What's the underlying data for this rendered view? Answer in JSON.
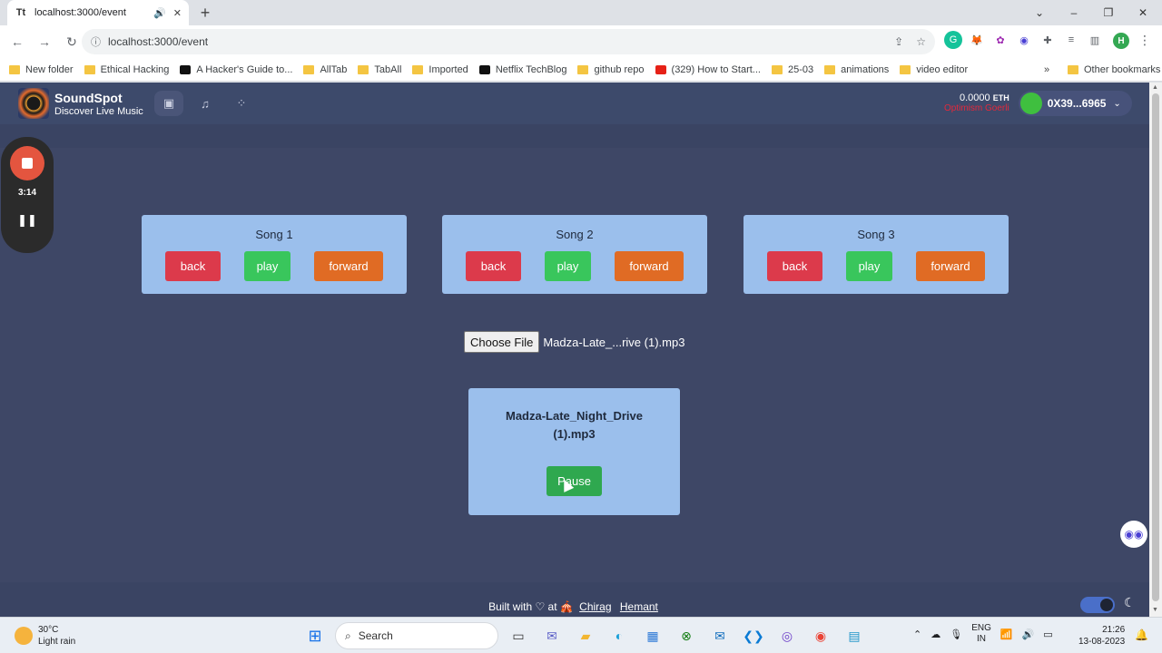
{
  "browser": {
    "tab_title": "localhost:3000/event",
    "tab_favicon": "Tt",
    "url": "localhost:3000/event",
    "profile_initial": "H",
    "bookmarks": [
      {
        "label": "New folder",
        "icon": "folder"
      },
      {
        "label": "Ethical Hacking",
        "icon": "folder"
      },
      {
        "label": "A Hacker's Guide to...",
        "icon": "medium"
      },
      {
        "label": "AllTab",
        "icon": "folder"
      },
      {
        "label": "TabAll",
        "icon": "folder"
      },
      {
        "label": "Imported",
        "icon": "folder"
      },
      {
        "label": "Netflix TechBlog",
        "icon": "medium"
      },
      {
        "label": "github repo",
        "icon": "folder"
      },
      {
        "label": "(329) How to Start...",
        "icon": "youtube"
      },
      {
        "label": "25-03",
        "icon": "folder"
      },
      {
        "label": "animations",
        "icon": "folder"
      },
      {
        "label": "video editor",
        "icon": "folder"
      }
    ],
    "bookmarks_more": "»",
    "other_bookmarks": "Other bookmarks"
  },
  "app": {
    "brand_name": "SoundSpot",
    "brand_tagline": "Discover Live Music",
    "balance": "0.0000",
    "currency": "ETH",
    "network": "Optimism Goerli",
    "account": "0X39...6965",
    "recorder_time": "3:14",
    "songs": [
      {
        "title": "Song 1",
        "back": "back",
        "play": "play",
        "forward": "forward"
      },
      {
        "title": "Song 2",
        "back": "back",
        "play": "play",
        "forward": "forward"
      },
      {
        "title": "Song 3",
        "back": "back",
        "play": "play",
        "forward": "forward"
      }
    ],
    "file_button": "Choose File",
    "file_name": "Madza-Late_...rive (1).mp3",
    "player_name": "Madza-Late_Night_Drive (1).mp3",
    "player_button": "Pause",
    "footer_prefix": "Built with ♡ at 🎪",
    "footer_link_1": "Chirag",
    "footer_link_2": "Hemant"
  },
  "taskbar": {
    "temperature": "30°C",
    "weather": "Light rain",
    "search_label": "Search",
    "lang_1": "ENG",
    "lang_2": "IN",
    "time": "21:26",
    "date": "13-08-2023"
  },
  "colors": {
    "page_bg": "#3e4766",
    "card_bg": "#9bbfec",
    "back": "#dc3a4b",
    "play": "#39c65c",
    "forward": "#e06b24",
    "pause": "#2fa84f"
  }
}
